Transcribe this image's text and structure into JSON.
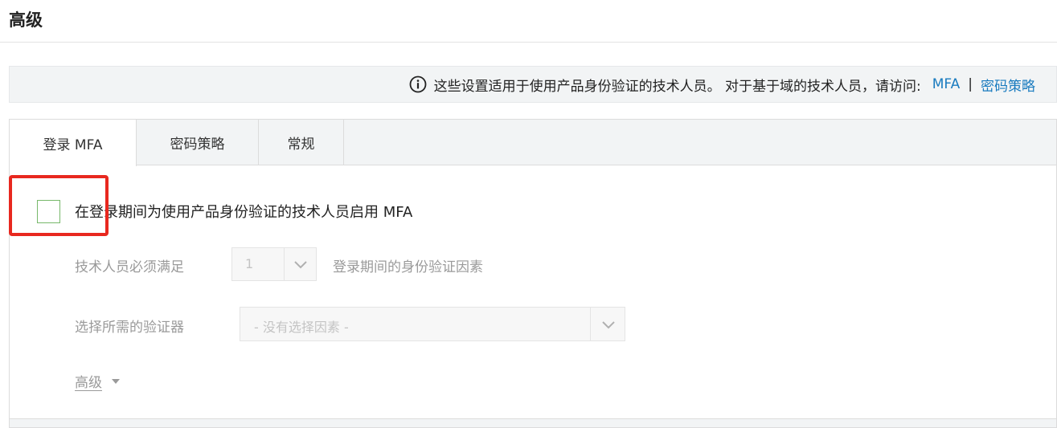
{
  "page": {
    "title": "高级"
  },
  "notice": {
    "text": "这些设置适用于使用产品身份验证的技术人员。 对于基于域的技术人员，请访问:",
    "link_mfa": "MFA",
    "separator": "|",
    "link_password_policy": "密码策略"
  },
  "tabs": [
    {
      "label": "登录 MFA",
      "active": true
    },
    {
      "label": "密码策略",
      "active": false
    },
    {
      "label": "常规",
      "active": false
    }
  ],
  "mfa": {
    "enable_label": "在登录期间为使用产品身份验证的技术人员启用 MFA",
    "enabled": false,
    "factor_prefix": "技术人员必须满足",
    "factor_count": "1",
    "factor_suffix": "登录期间的身份验证因素",
    "authenticator_label": "选择所需的验证器",
    "authenticator_placeholder": "- 没有选择因素 -",
    "advanced_label": "高级"
  },
  "colors": {
    "link": "#1a7bbf",
    "checkbox_border": "#77b86a",
    "highlight": "#e8281f",
    "disabled_text": "#9a9a9a"
  }
}
